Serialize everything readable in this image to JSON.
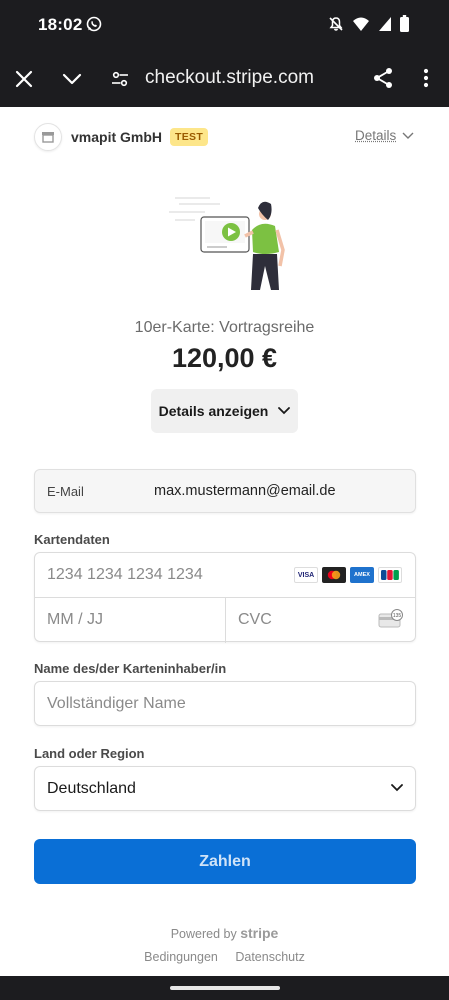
{
  "status_bar": {
    "time": "18:02"
  },
  "browser": {
    "url": "checkout.stripe.com"
  },
  "merchant": {
    "name": "vmapit GmbH",
    "badge": "TEST",
    "details_link": "Details"
  },
  "product": {
    "name": "10er-Karte: Vortragsreihe",
    "price": "120,00 €",
    "show_details_label": "Details anzeigen"
  },
  "email": {
    "label": "E-Mail",
    "value": "max.mustermann@email.de"
  },
  "card": {
    "section_label": "Kartendaten",
    "number_placeholder": "1234 1234 1234 1234",
    "expiry_placeholder": "MM / JJ",
    "cvc_placeholder": "CVC",
    "brands": [
      "VISA",
      "Mastercard",
      "AMEX",
      "JCB"
    ]
  },
  "cardholder": {
    "section_label": "Name des/der Karteninhaber/in",
    "placeholder": "Vollständiger Name"
  },
  "country": {
    "section_label": "Land oder Region",
    "selected": "Deutschland"
  },
  "pay_button": {
    "label": "Zahlen"
  },
  "footer": {
    "powered_by": "Powered by",
    "brand": "stripe",
    "links": [
      "Bedingungen",
      "Datenschutz"
    ]
  },
  "colors": {
    "accent": "#0a6fd6",
    "test_badge": "#fde68a",
    "illustration_green": "#7cc142"
  }
}
